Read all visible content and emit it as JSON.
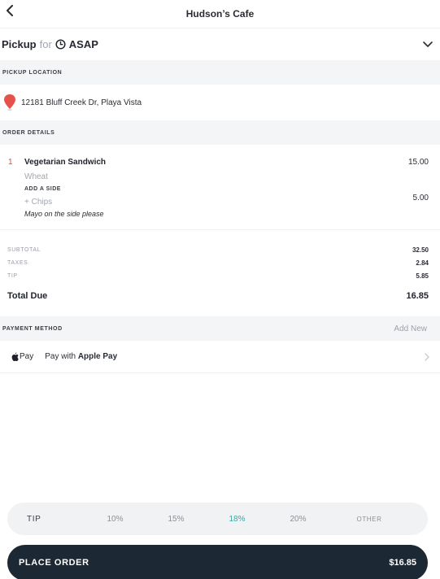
{
  "header": {
    "title": "Hudson’s Cafe",
    "back_icon": "back-chevron-icon"
  },
  "pickup": {
    "mode": "Pickup",
    "for_text": "for",
    "time": "ASAP",
    "clock_icon": "clock-icon",
    "toggle_icon": "chevron-down-icon"
  },
  "pickup_location": {
    "section_label": "PICKUP LOCATION",
    "address": "12181 Bluff Creek Dr, Playa Vista",
    "pin_icon": "map-pin-icon",
    "pin_color": "#e5524a"
  },
  "order_details": {
    "section_label": "ORDER DETAILS",
    "items": [
      {
        "quantity": "1",
        "name": "Vegetarian Sandwich",
        "price": "15.00",
        "option": "Wheat",
        "addon_label": "ADD A SIDE",
        "side_name": "+ Chips",
        "side_price": "5.00",
        "note": "Mayo on the side please"
      }
    ]
  },
  "totals": {
    "subtotal_label": "SUBTOTAL",
    "subtotal": "32.50",
    "taxes_label": "TAXES",
    "taxes": "2.84",
    "tip_label": "TIP",
    "tip": "5.85",
    "due_label": "Total Due",
    "due": "16.85"
  },
  "payment": {
    "section_label": "PAYMENT METHOD",
    "add_new": "Add New",
    "badge_text": "Pay",
    "pay_prefix": "Pay with",
    "pay_method": "Apple Pay",
    "apple_icon": "apple-logo-icon",
    "chevron_icon": "chevron-right-icon"
  },
  "tip_selector": {
    "label": "TIP",
    "options": [
      "10%",
      "15%",
      "18%",
      "20%"
    ],
    "selected": "18%",
    "other": "OTHER",
    "accent_color": "#3aa79f"
  },
  "place_order": {
    "label": "PLACE ORDER",
    "total": "$16.85",
    "bg_color": "#1c2833"
  }
}
